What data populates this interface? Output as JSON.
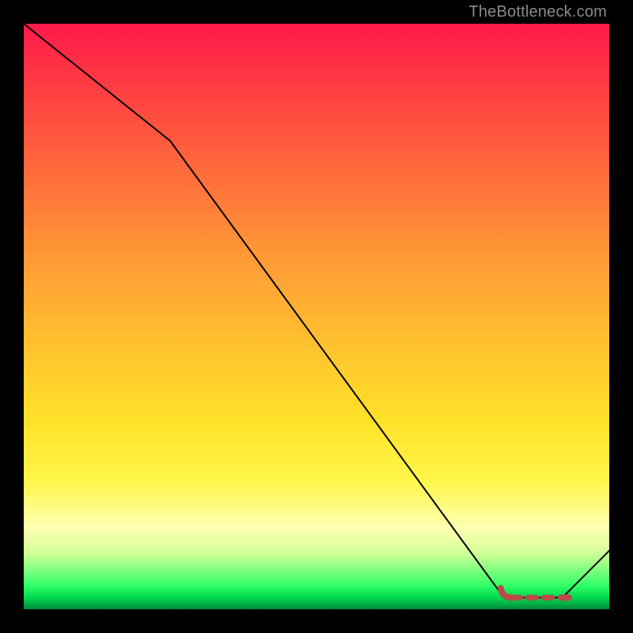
{
  "watermark": "TheBottleneck.com",
  "colors": {
    "background": "#000000",
    "curve": "#000000",
    "marker": "#b94a4a",
    "gradient_top": "#ff1a4b",
    "gradient_bottom": "#008a3a"
  },
  "chart_data": {
    "type": "line",
    "title": "",
    "xlabel": "",
    "ylabel": "",
    "xlim": [
      0,
      100
    ],
    "ylim": [
      0,
      100
    ],
    "grid": false,
    "series": [
      {
        "name": "curve",
        "x": [
          0,
          25,
          82,
          92,
          100
        ],
        "values": [
          100,
          80,
          2,
          2,
          10
        ]
      }
    ],
    "highlight": {
      "name": "flat-minimum",
      "x_start": 82,
      "x_end": 92,
      "value": 2,
      "style": "dashed"
    }
  }
}
